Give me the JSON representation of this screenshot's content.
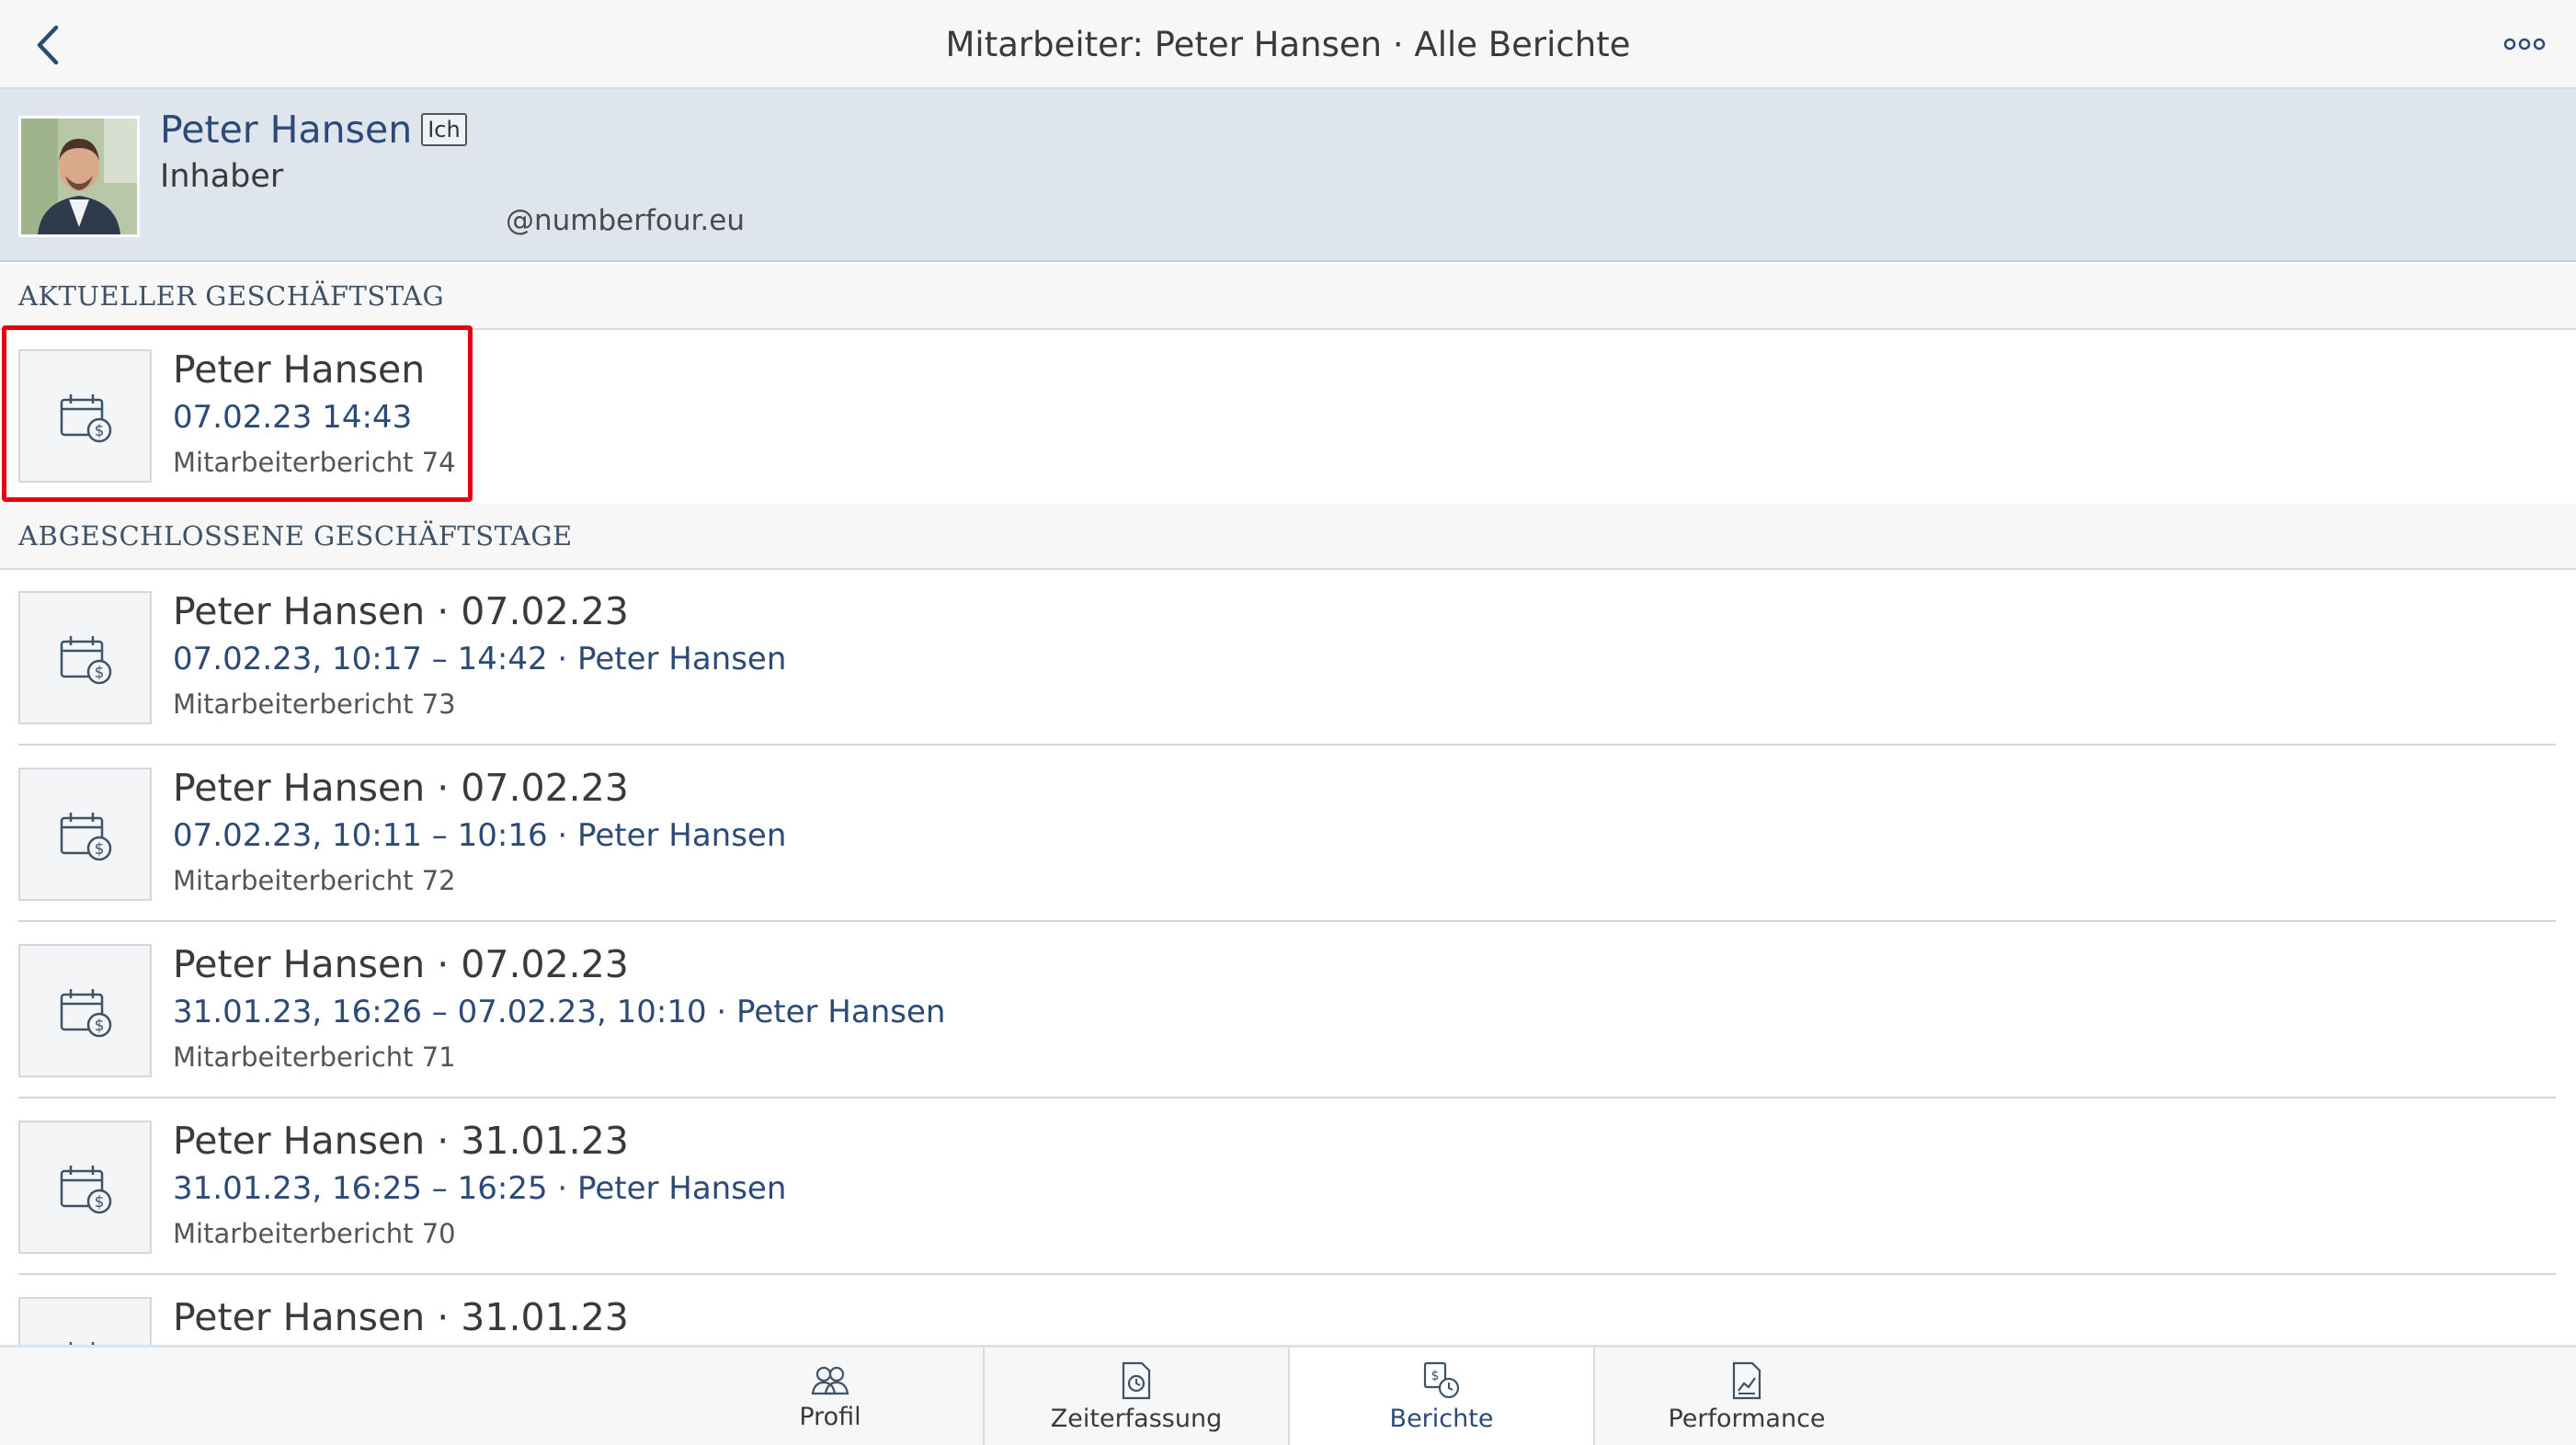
{
  "navbar": {
    "title": "Mitarbeiter: Peter Hansen · Alle Berichte",
    "back_icon": "chevron-left-icon",
    "more_icon": "more-horizontal-icon"
  },
  "profile": {
    "name": "Peter Hansen",
    "badge": "Ich",
    "role": "Inhaber",
    "email": "@numberfour.eu"
  },
  "sections": {
    "current": "AKTUELLER GESCHÄFTSTAG",
    "closed": "ABGESCHLOSSENE GESCHÄFTSTAGE"
  },
  "current_report": {
    "title": "Peter Hansen",
    "time": "07.02.23 14:43",
    "subtitle": "Mitarbeiterbericht 74"
  },
  "closed_reports": [
    {
      "title": "Peter Hansen · 07.02.23",
      "time": "07.02.23, 10:17 – 14:42 · Peter Hansen",
      "subtitle": "Mitarbeiterbericht 73"
    },
    {
      "title": "Peter Hansen · 07.02.23",
      "time": "07.02.23, 10:11 – 10:16 · Peter Hansen",
      "subtitle": "Mitarbeiterbericht 72"
    },
    {
      "title": "Peter Hansen · 07.02.23",
      "time": "31.01.23, 16:26 – 07.02.23, 10:10 · Peter Hansen",
      "subtitle": "Mitarbeiterbericht 71"
    },
    {
      "title": "Peter Hansen · 31.01.23",
      "time": "31.01.23, 16:25 – 16:25 · Peter Hansen",
      "subtitle": "Mitarbeiterbericht 70"
    },
    {
      "title": "Peter Hansen · 31.01.23",
      "time": "",
      "subtitle": ""
    }
  ],
  "tabs": [
    {
      "label": "Profil",
      "icon": "people-icon"
    },
    {
      "label": "Zeiterfassung",
      "icon": "clock-document-icon"
    },
    {
      "label": "Berichte",
      "icon": "reports-icon",
      "active": true
    },
    {
      "label": "Performance",
      "icon": "chart-document-icon"
    }
  ],
  "colors": {
    "accent": "#2b4a78",
    "highlight": "#e3000f",
    "header_bg": "#dfe5ec"
  }
}
